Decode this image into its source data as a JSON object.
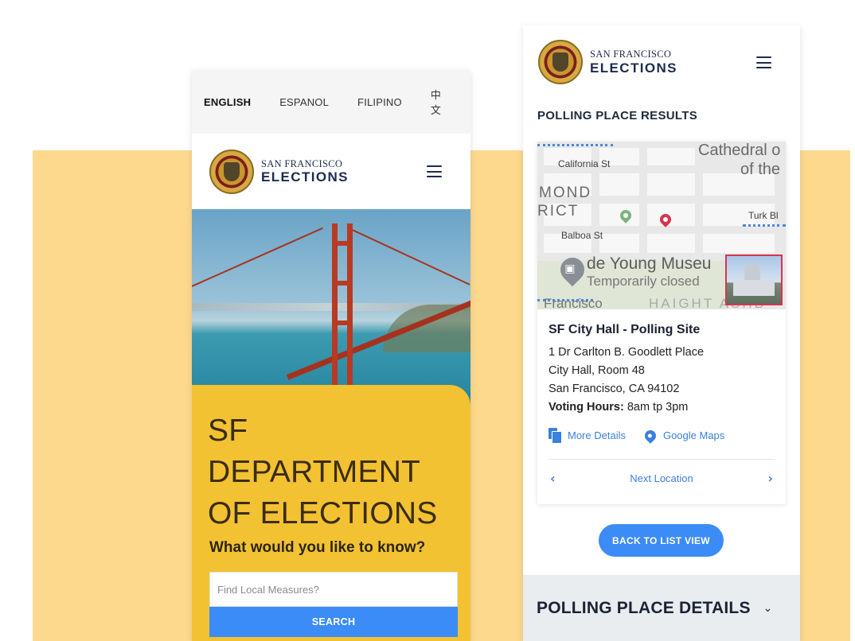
{
  "left_phone": {
    "languages": [
      "ENGLISH",
      "ESPANOL",
      "FILIPINO",
      "中文"
    ],
    "active_language": "ENGLISH",
    "brand": {
      "top": "SAN FRANCISCO",
      "bottom": "ELECTIONS"
    },
    "hero": {
      "title_lines": [
        "SF",
        "DEPARTMENT",
        "OF ELECTIONS"
      ],
      "question": "What would you like to know?"
    },
    "search": {
      "placeholder": "Find Local Measures?",
      "button_label": "SEARCH"
    }
  },
  "right_phone": {
    "brand": {
      "top": "SAN FRANCISCO",
      "bottom": "ELECTIONS"
    },
    "section_title": "POLLING PLACE RESULTS",
    "map": {
      "labels": {
        "cathedral_1": "Cathedral o",
        "cathedral_2": "of the",
        "california": "California St",
        "mond": "MOND",
        "rict": "RICT",
        "turk": "Turk Bl",
        "balboa": "Balboa St",
        "museum": "de Young Museu",
        "closed": "Temporarily closed",
        "francisco": "Francisco",
        "haight": "HAIGHT ASHB"
      }
    },
    "result": {
      "name": "SF City Hall - Polling Site",
      "address_line1": "1 Dr Carlton B. Goodlett Place",
      "address_line2": "City Hall, Room 48",
      "address_line3": "San Francisco, CA 94102",
      "hours_label": "Voting Hours:",
      "hours_value": "8am tp 3pm",
      "more_details": "More Details",
      "google_maps": "Google Maps",
      "next_location": "Next Location"
    },
    "back_button": "BACK TO LIST VIEW",
    "details_title": "POLLING PLACE DETAILS"
  },
  "colors": {
    "backdrop": "#fdd98e",
    "hero_card": "#f3c232",
    "accent_blue": "#3b8cf6",
    "pin_red": "#d8344f"
  }
}
